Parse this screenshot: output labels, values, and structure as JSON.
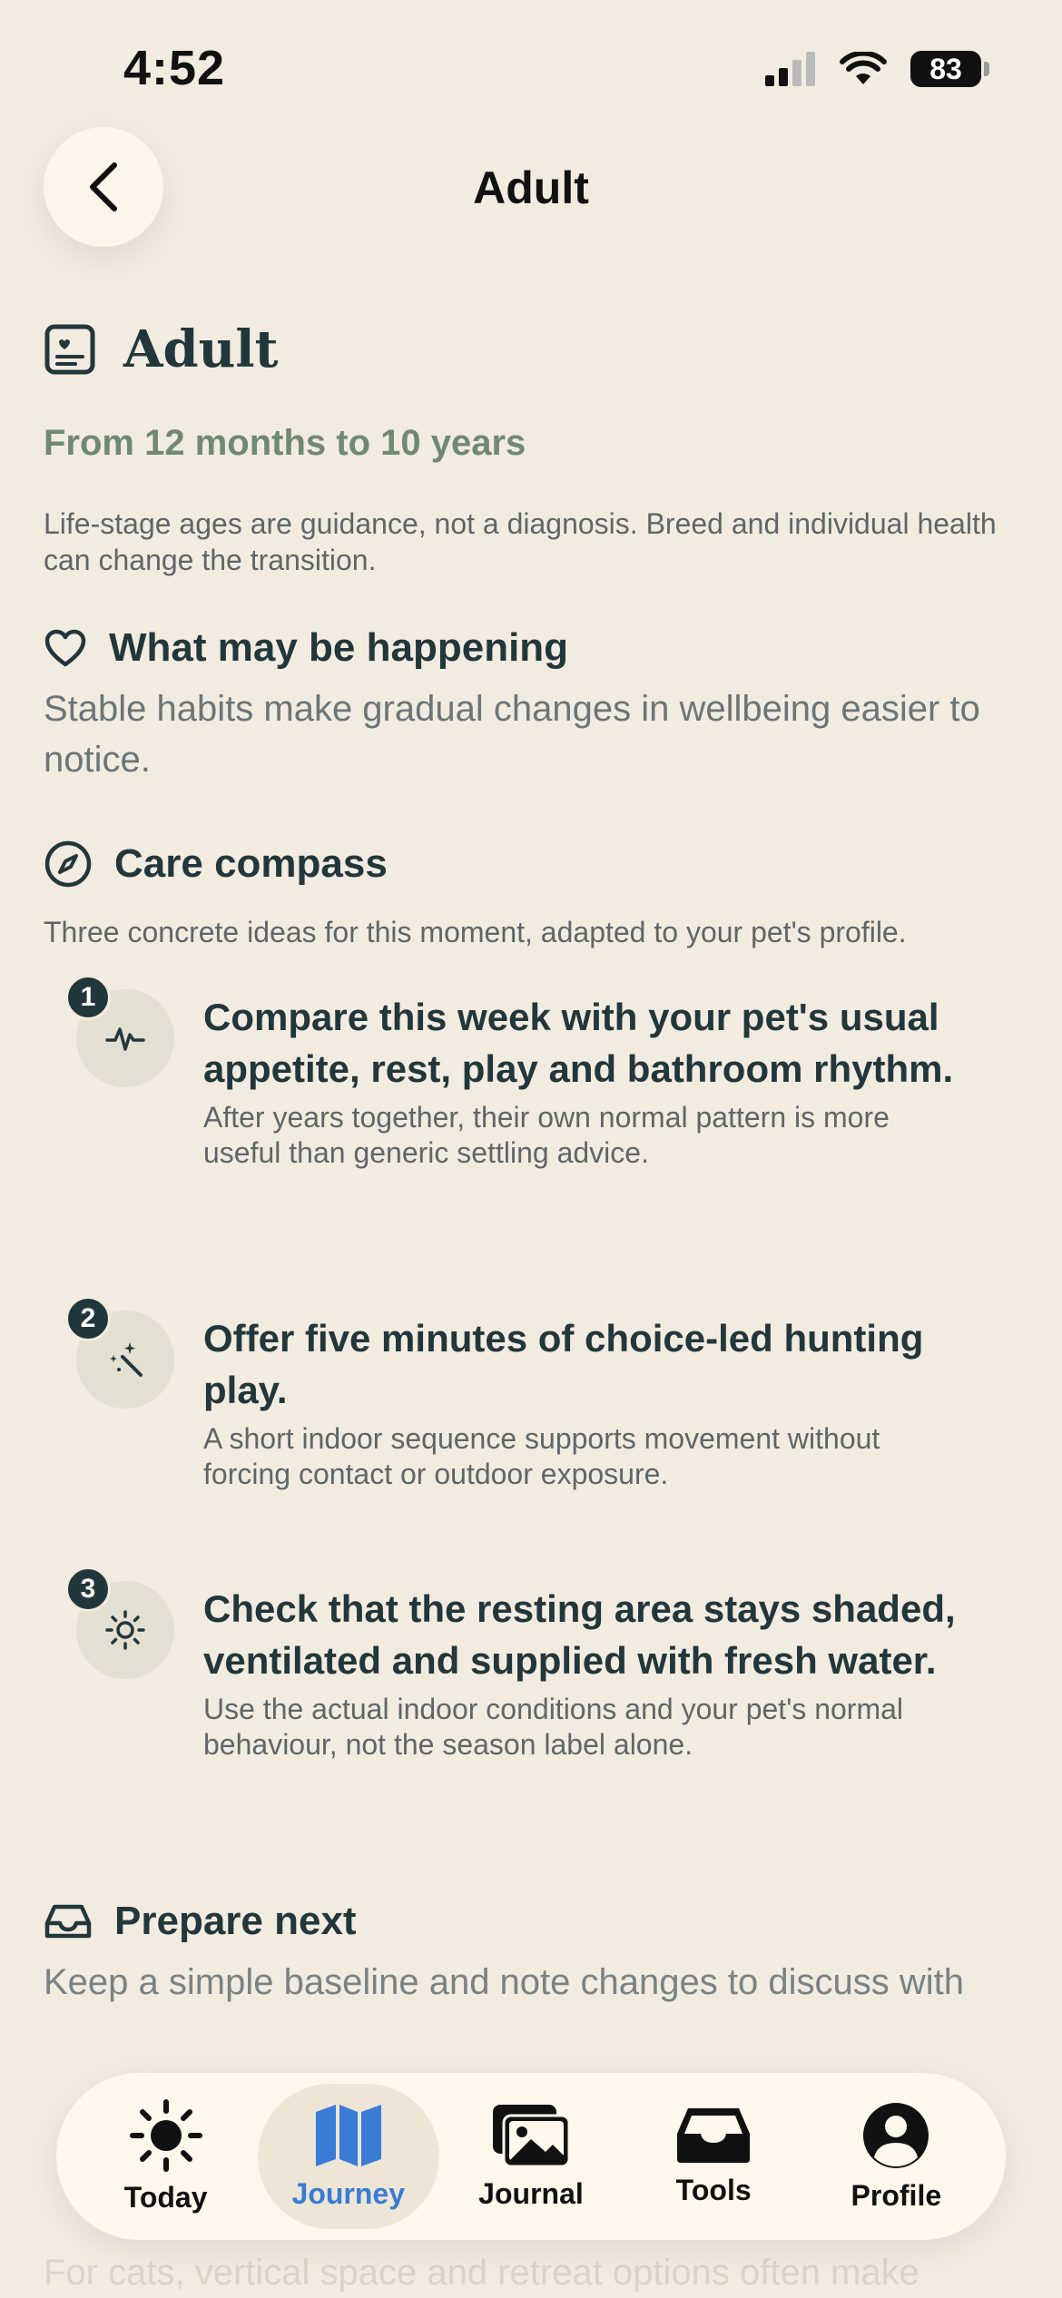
{
  "status_bar": {
    "time": "4:52",
    "battery": "83"
  },
  "nav": {
    "title": "Adult"
  },
  "header": {
    "title": "Adult",
    "age_range": "From 12 months to 10 years",
    "disclaimer": "Life-stage ages are guidance, not a diagnosis. Breed and individual health can change the transition."
  },
  "happening": {
    "title": "What may be happening",
    "text": "Stable habits make gradual changes in wellbeing easier to notice."
  },
  "compass": {
    "title": "Care compass",
    "subtitle": "Three concrete ideas for this moment, adapted to your pet's profile.",
    "ideas": [
      {
        "number": "1",
        "icon": "pulse-icon",
        "title": "Compare this week with your pet's usual appetite, rest, play and bathroom rhythm.",
        "desc": "After years together, their own normal pattern is more useful than generic settling advice."
      },
      {
        "number": "2",
        "icon": "sparkle-wand-icon",
        "title": "Offer five minutes of choice-led hunting play.",
        "desc": "A short indoor sequence supports movement without forcing contact or outdoor exposure."
      },
      {
        "number": "3",
        "icon": "sun-icon",
        "title": "Check that the resting area stays shaded, ventilated and supplied with fresh water.",
        "desc": "Use the actual indoor conditions and your pet's normal behaviour, not the season label alone."
      }
    ]
  },
  "prepare": {
    "title": "Prepare next",
    "text": "Keep a simple baseline and note changes to discuss with"
  },
  "faded_section": {
    "text": "For cats, vertical space and retreat options often make"
  },
  "tabs": [
    {
      "label": "Today",
      "icon": "sun-icon",
      "active": false
    },
    {
      "label": "Journey",
      "icon": "map-icon",
      "active": true
    },
    {
      "label": "Journal",
      "icon": "photos-icon",
      "active": false
    },
    {
      "label": "Tools",
      "icon": "tray-icon",
      "active": false
    },
    {
      "label": "Profile",
      "icon": "person-icon",
      "active": false
    }
  ],
  "colors": {
    "background": "#f2ebe0",
    "accent": "#3a7bd5",
    "age_green": "#6f8a6f",
    "ink": "#22373b"
  }
}
